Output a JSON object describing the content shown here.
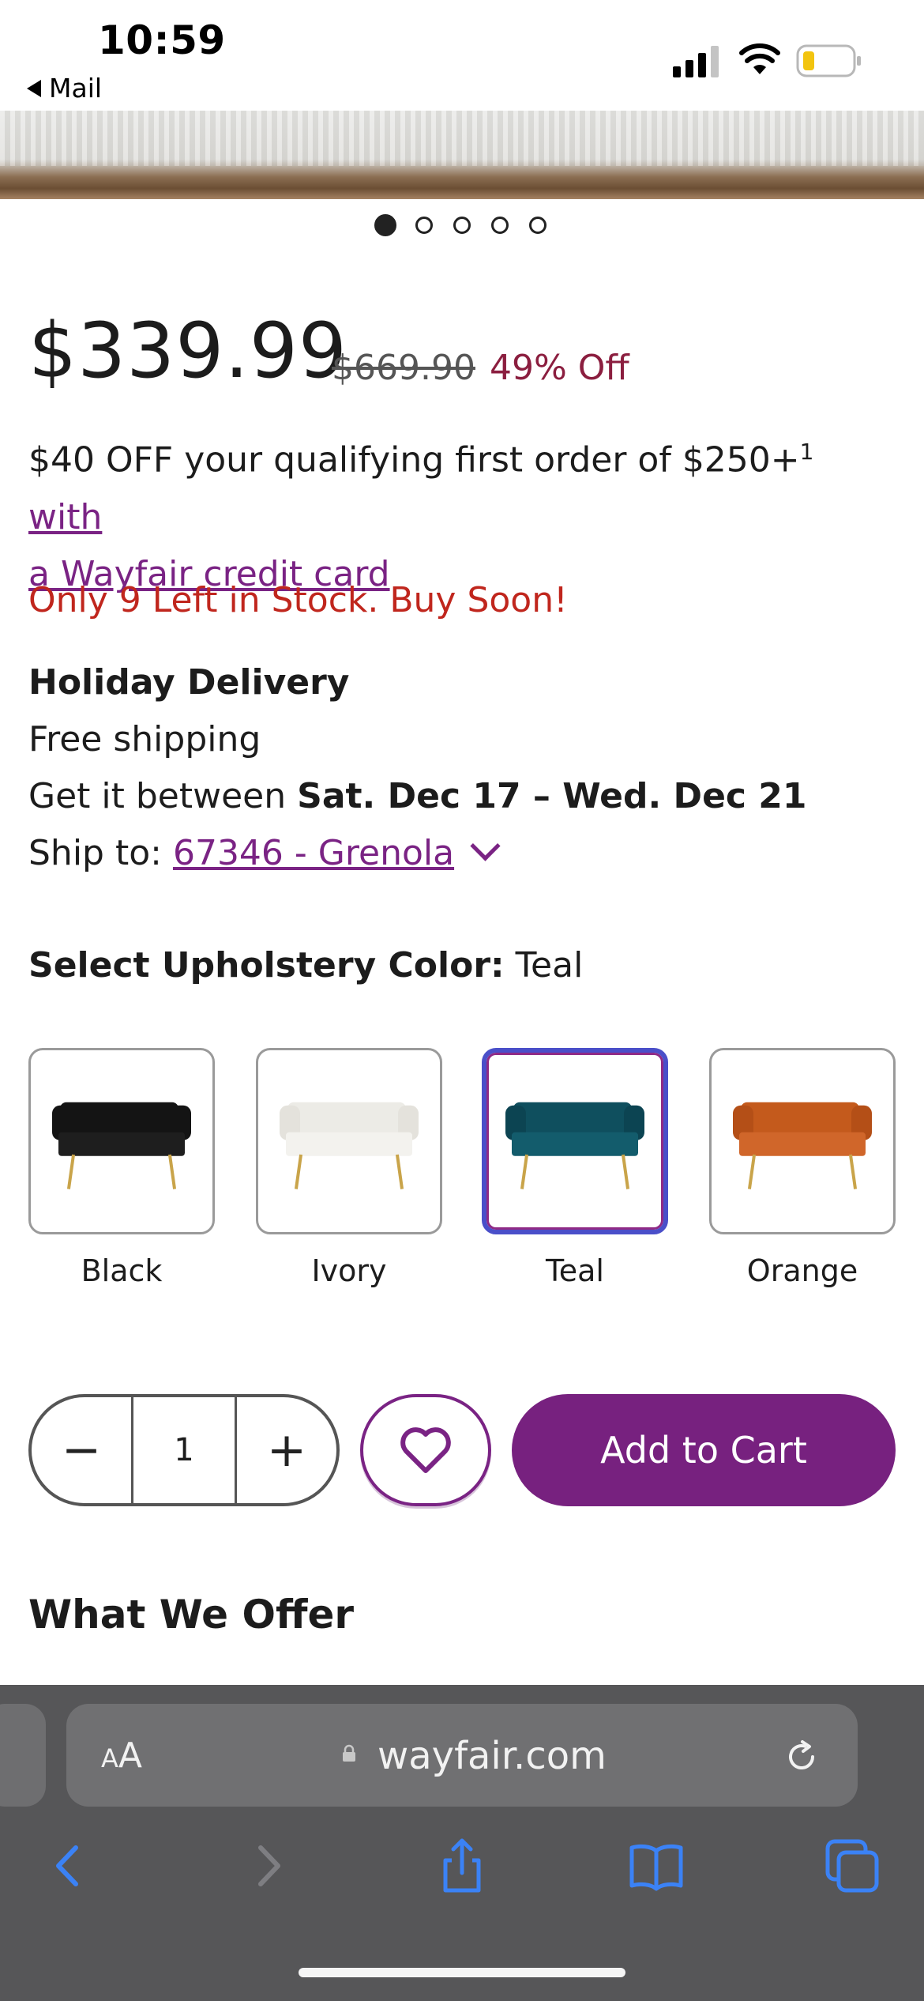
{
  "status_bar": {
    "time": "10:59",
    "back_app": "Mail"
  },
  "carousel": {
    "count": 5,
    "active_index": 0
  },
  "pricing": {
    "price": "$339.99",
    "original_price": "$669.90",
    "discount": "49% Off"
  },
  "promo": {
    "text": "$40 OFF your qualifying first order of $250+",
    "footnote": "1",
    "link_a": "with",
    "link_b": "a Wayfair credit card"
  },
  "stock_message": "Only 9 Left in Stock. Buy Soon!",
  "delivery": {
    "title": "Holiday Delivery",
    "shipping": "Free shipping",
    "window_prefix": "Get it between ",
    "window_dates": "Sat. Dec 17 – Wed. Dec 21",
    "ship_to_label": "Ship to: ",
    "ship_to_value": "67346 - Grenola"
  },
  "color_selector": {
    "label": "Select Upholstery Color:",
    "selected": "Teal",
    "options": [
      {
        "name": "Black",
        "color": "#141414",
        "leg": "#c9a44a"
      },
      {
        "name": "Ivory",
        "color": "#ecebe6",
        "leg": "#c9a44a"
      },
      {
        "name": "Teal",
        "color": "#0f4f5e",
        "leg": "#c9a44a"
      },
      {
        "name": "Orange",
        "color": "#c45a1c",
        "leg": "#c9a44a"
      }
    ]
  },
  "cart": {
    "quantity": "1",
    "minus": "−",
    "plus": "+",
    "add_to_cart": "Add to Cart"
  },
  "section_heading": "What We Offer",
  "safari": {
    "aa_label_small": "A",
    "aa_label_big": "A",
    "url": "wayfair.com"
  },
  "colors": {
    "brand_purple": "#77217f",
    "discount_red": "#8b1e3f",
    "stock_red": "#c0261d",
    "safari_blue": "#3b82f6"
  }
}
